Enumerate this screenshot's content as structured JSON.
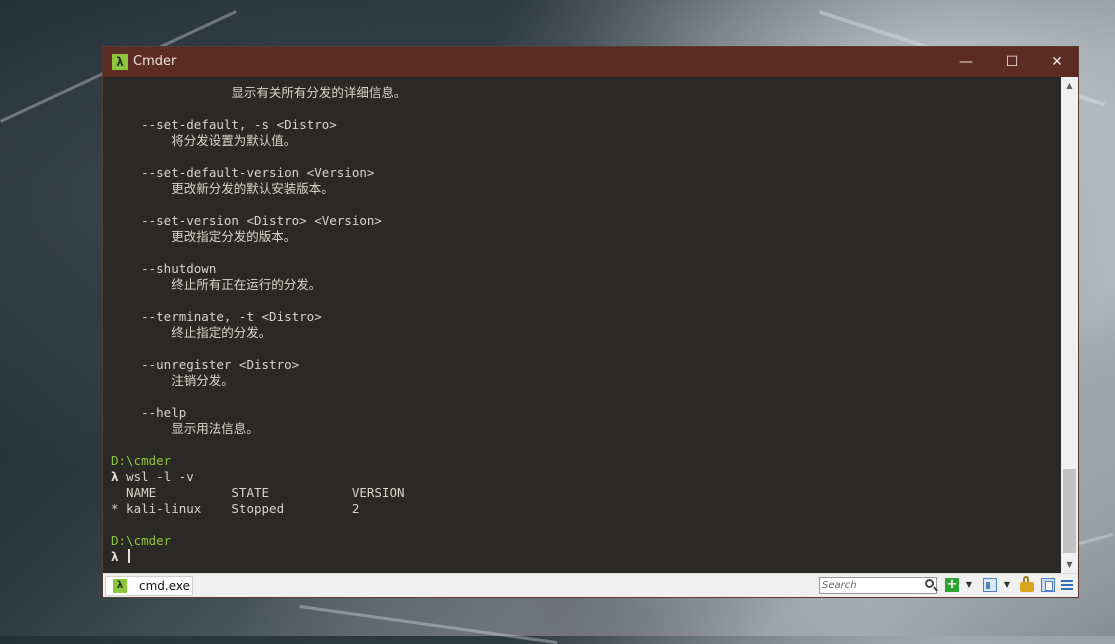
{
  "window": {
    "title": "Cmder",
    "app_icon": "λ",
    "minimize_glyph": "—",
    "maximize_glyph": "☐",
    "close_glyph": "✕"
  },
  "console": {
    "lines": [
      "                显示有关所有分发的详细信息。",
      "",
      "    --set-default, -s <Distro>",
      "        将分发设置为默认值。",
      "",
      "    --set-default-version <Version>",
      "        更改新分发的默认安装版本。",
      "",
      "    --set-version <Distro> <Version>",
      "        更改指定分发的版本。",
      "",
      "    --shutdown",
      "        终止所有正在运行的分发。",
      "",
      "    --terminate, -t <Distro>",
      "        终止指定的分发。",
      "",
      "    --unregister <Distro>",
      "        注销分发。",
      "",
      "    --help",
      "        显示用法信息。",
      "",
      "D:\\cmder",
      "λ wsl -l -v",
      "  NAME          STATE           VERSION",
      "* kali-linux    Stopped         2",
      "",
      "D:\\cmder",
      "λ "
    ],
    "prompt_path": "D:\\cmder",
    "prompt_symbol": "λ",
    "last_command": "wsl -l -v",
    "path_color": "#8dc63f",
    "text_color": "#d8d4cc",
    "background_color": "#2b2925"
  },
  "scrollbar": {
    "up_glyph": "▲",
    "down_glyph": "▼"
  },
  "statusbar": {
    "tab_label": "cmd.exe",
    "tab_icon": "λ",
    "search_placeholder": "Search",
    "new_console_glyph": "+",
    "dropdown_glyph": "▼"
  }
}
